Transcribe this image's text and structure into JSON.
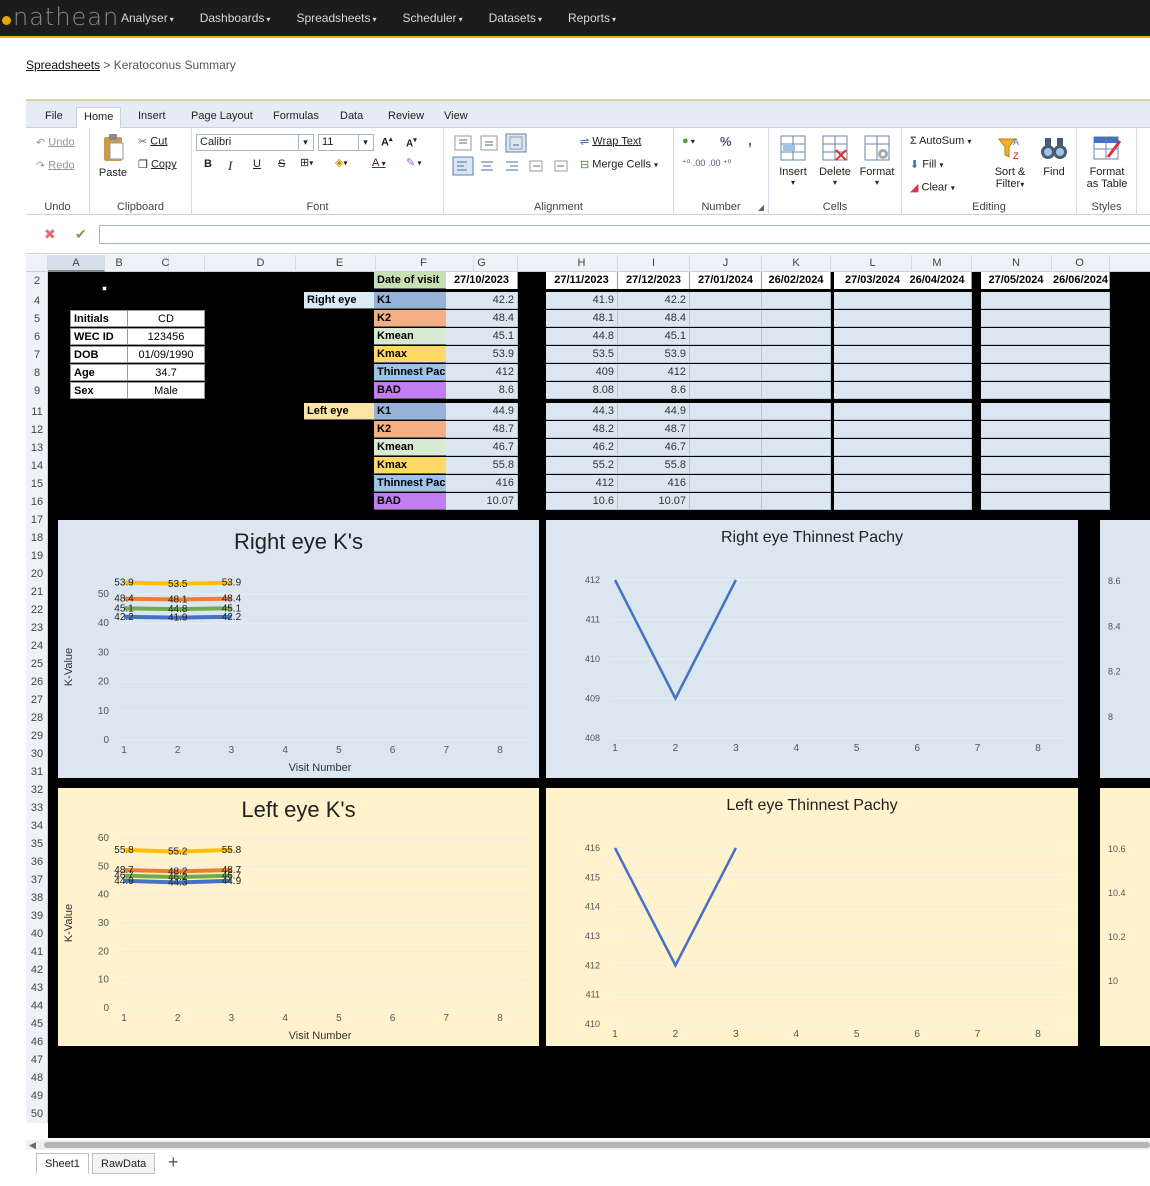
{
  "brand": {
    "name": "nathean"
  },
  "nav": [
    "Analyser",
    "Dashboards",
    "Spreadsheets",
    "Scheduler",
    "Datasets",
    "Reports"
  ],
  "breadcrumb": {
    "link": "Spreadsheets",
    "sep": " > ",
    "current": "Keratoconus Summary"
  },
  "ribbon": {
    "tabs": [
      "File",
      "Home",
      "Insert",
      "Page Layout",
      "Formulas",
      "Data",
      "Review",
      "View"
    ],
    "active_tab": "Home",
    "undo": "Undo",
    "redo": "Redo",
    "undo_group": "Undo",
    "paste": "Paste",
    "cut": "Cut",
    "copy": "Copy",
    "clipboard_group": "Clipboard",
    "font_name": "Calibri",
    "font_size": "11",
    "font_group": "Font",
    "bold": "B",
    "italic": "I",
    "underline": "U",
    "strike": "S",
    "grow": "A",
    "shrink": "A",
    "font_color": "A",
    "wrap": "Wrap Text",
    "merge": "Merge Cells",
    "alignment_group": "Alignment",
    "percent": "%",
    "comma": ",",
    "number_group": "Number",
    "insert": "Insert",
    "delete": "Delete",
    "format": "Format",
    "cells_group": "Cells",
    "autosum": "AutoSum",
    "fill": "Fill",
    "clear": "Clear",
    "sort": "Sort &",
    "filter": "Filter",
    "find": "Find",
    "editing_group": "Editing",
    "format_table_1": "Format",
    "format_table_2": "as Table",
    "styles_group": "Styles"
  },
  "columns": [
    "A",
    "B",
    "C",
    "D",
    "E",
    "F",
    "G",
    "H",
    "I",
    "J",
    "K",
    "L",
    "M",
    "N",
    "O"
  ],
  "rows": [
    "2",
    "3",
    "4",
    "5",
    "6",
    "7",
    "8",
    "9",
    "10",
    "11",
    "12",
    "13",
    "14",
    "15",
    "16",
    "17",
    "18",
    "19",
    "20",
    "21",
    "22",
    "23",
    "24",
    "25",
    "26",
    "27",
    "28",
    "29",
    "30",
    "31",
    "32",
    "33",
    "34",
    "35",
    "36",
    "37",
    "38",
    "39",
    "40",
    "41",
    "42",
    "43",
    "44",
    "45",
    "46",
    "47",
    "48",
    "49",
    "50"
  ],
  "header": {
    "label": "Date of visit",
    "dates": [
      "27/10/2023",
      "27/11/2023",
      "27/12/2023",
      "27/01/2024",
      "26/02/2024",
      "27/03/2024",
      "26/04/2024",
      "27/05/2024",
      "26/06/2024"
    ]
  },
  "patient": [
    {
      "label": "Initials",
      "value": "CD"
    },
    {
      "label": "WEC ID",
      "value": "123456"
    },
    {
      "label": "DOB",
      "value": "01/09/1990"
    },
    {
      "label": "Age",
      "value": "34.7"
    },
    {
      "label": "Sex",
      "value": "Male"
    }
  ],
  "right_eye": {
    "label": "Right eye",
    "rows": [
      {
        "label": "K1",
        "color": "#95b3d7",
        "values": [
          "42.2",
          "41.9",
          "42.2"
        ]
      },
      {
        "label": "K2",
        "color": "#f4b084",
        "values": [
          "48.4",
          "48.1",
          "48.4"
        ]
      },
      {
        "label": "Kmean",
        "color": "#d9ead3",
        "values": [
          "45.1",
          "44.8",
          "45.1"
        ]
      },
      {
        "label": "Kmax",
        "color": "#ffd966",
        "values": [
          "53.9",
          "53.5",
          "53.9"
        ]
      },
      {
        "label": "Thinnest Pachy",
        "color": "#9dc3e6",
        "values": [
          "412",
          "409",
          "412"
        ]
      },
      {
        "label": "BAD",
        "color": "#c27ef0",
        "values": [
          "8.6",
          "8.08",
          "8.6"
        ]
      }
    ]
  },
  "left_eye": {
    "label": "Left eye",
    "rows": [
      {
        "label": "K1",
        "color": "#95b3d7",
        "values": [
          "44.9",
          "44.3",
          "44.9"
        ]
      },
      {
        "label": "K2",
        "color": "#f4b084",
        "values": [
          "48.7",
          "48.2",
          "48.7"
        ]
      },
      {
        "label": "Kmean",
        "color": "#d9ead3",
        "values": [
          "46.7",
          "46.2",
          "46.7"
        ]
      },
      {
        "label": "Kmax",
        "color": "#ffd966",
        "values": [
          "55.8",
          "55.2",
          "55.8"
        ]
      },
      {
        "label": "Thinnest Pachy",
        "color": "#9dc3e6",
        "values": [
          "416",
          "412",
          "416"
        ]
      },
      {
        "label": "BAD",
        "color": "#c27ef0",
        "values": [
          "10.07",
          "10.6",
          "10.07"
        ]
      }
    ]
  },
  "chart_data": [
    {
      "type": "line",
      "title": "Right eye K's",
      "xlabel": "Visit Number",
      "ylabel": "K-Value",
      "bg": "#dce6f1",
      "x": [
        1,
        2,
        3
      ],
      "xticks": [
        1,
        2,
        3,
        4,
        5,
        6,
        7,
        8
      ],
      "ylim": [
        0,
        50
      ],
      "yticks": [
        0,
        10,
        20,
        30,
        40,
        50
      ],
      "series": [
        {
          "color": "#ffc000",
          "values": [
            53.9,
            53.5,
            53.9
          ]
        },
        {
          "color": "#ed7d31",
          "values": [
            48.4,
            48.1,
            48.4
          ]
        },
        {
          "color": "#70ad47",
          "values": [
            45.1,
            44.8,
            45.1
          ]
        },
        {
          "color": "#4472c4",
          "values": [
            42.2,
            41.9,
            42.2
          ]
        }
      ],
      "data_labels": true
    },
    {
      "type": "line",
      "title": "Right eye Thinnest Pachy",
      "bg": "#dce6f1",
      "x": [
        1,
        2,
        3
      ],
      "xticks": [
        1,
        2,
        3,
        4,
        5,
        6,
        7,
        8
      ],
      "ylim": [
        408,
        412
      ],
      "yticks": [
        408,
        409,
        410,
        411,
        412
      ],
      "series": [
        {
          "color": "#4472c4",
          "values": [
            412,
            409,
            412
          ]
        }
      ]
    },
    {
      "type": "line",
      "title": "Left eye K's",
      "xlabel": "Visit Number",
      "ylabel": "K-Value",
      "bg": "#fff2cc",
      "x": [
        1,
        2,
        3
      ],
      "xticks": [
        1,
        2,
        3,
        4,
        5,
        6,
        7,
        8
      ],
      "ylim": [
        0,
        60
      ],
      "yticks": [
        0,
        10,
        20,
        30,
        40,
        50,
        60
      ],
      "series": [
        {
          "color": "#ffc000",
          "values": [
            55.8,
            55.2,
            55.8
          ]
        },
        {
          "color": "#ed7d31",
          "values": [
            48.7,
            48.2,
            48.7
          ]
        },
        {
          "color": "#70ad47",
          "values": [
            46.7,
            46.2,
            46.7
          ]
        },
        {
          "color": "#4472c4",
          "values": [
            44.9,
            44.3,
            44.9
          ]
        }
      ],
      "data_labels": true
    },
    {
      "type": "line",
      "title": "Left eye Thinnest Pachy",
      "bg": "#fff2cc",
      "x": [
        1,
        2,
        3
      ],
      "xticks": [
        1,
        2,
        3,
        4,
        5,
        6,
        7,
        8
      ],
      "ylim": [
        410,
        416
      ],
      "yticks": [
        410,
        411,
        412,
        413,
        414,
        415,
        416
      ],
      "series": [
        {
          "color": "#4472c4",
          "values": [
            416,
            412,
            416
          ]
        }
      ]
    },
    {
      "type": "line",
      "title": "",
      "bg": "#dce6f1",
      "partial": true,
      "yticks": [
        8,
        8.2,
        8.4,
        8.6
      ]
    },
    {
      "type": "line",
      "title": "",
      "bg": "#fff2cc",
      "partial": true,
      "yticks": [
        10,
        10.2,
        10.4,
        10.6
      ]
    }
  ],
  "sheet_tabs": [
    "Sheet1",
    "RawData"
  ],
  "add_sheet": "+",
  "colors": {
    "accent": "#e6b800",
    "navbg": "#1c1c1c"
  }
}
